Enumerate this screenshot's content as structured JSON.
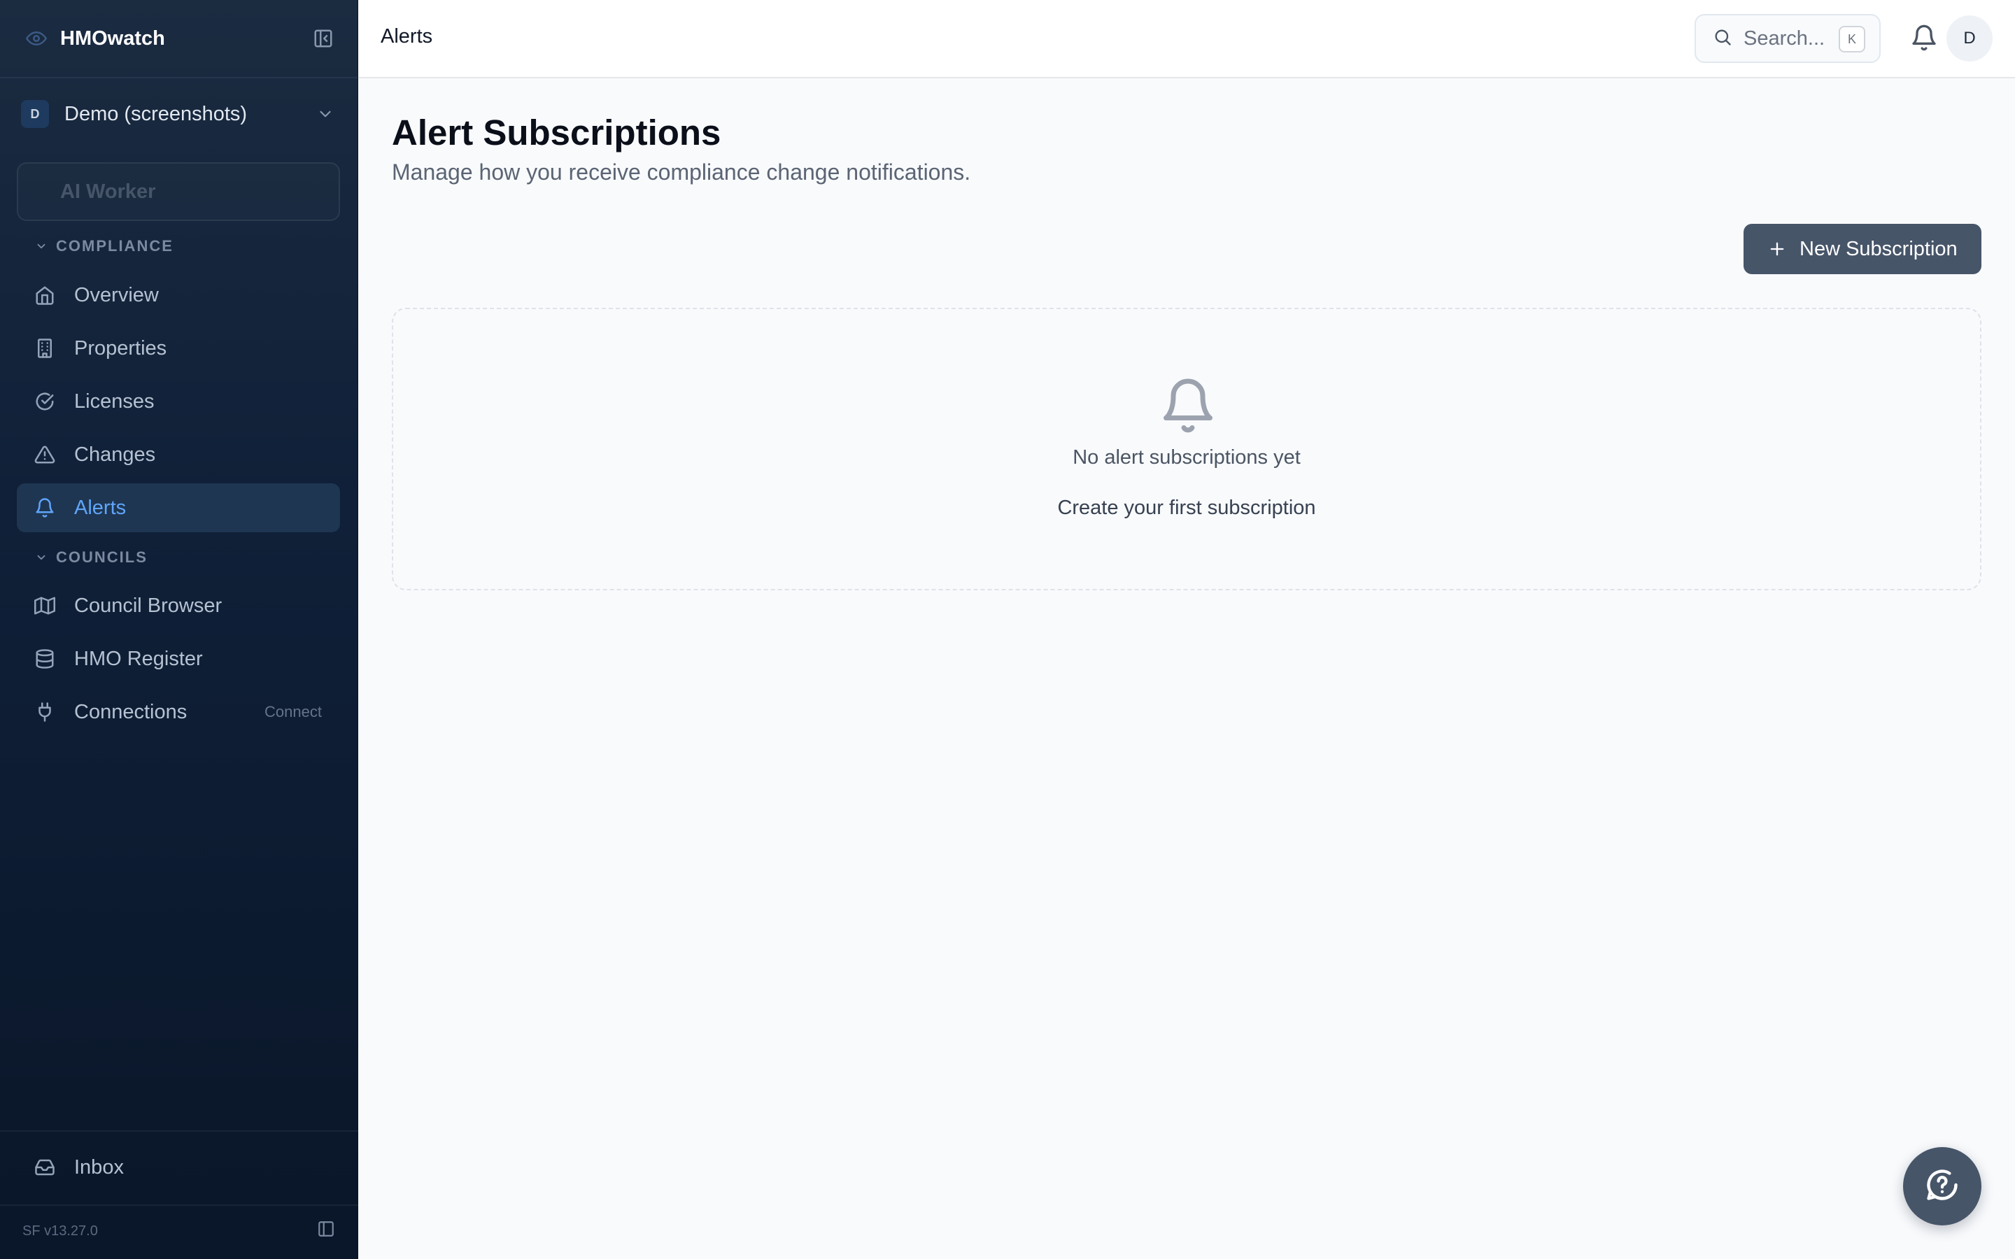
{
  "app": {
    "name": "HMOwatch",
    "version": "SF v13.27.0"
  },
  "org": {
    "badge": "D",
    "name": "Demo (screenshots)"
  },
  "sidebar": {
    "ai_worker": "AI Worker",
    "sections": [
      {
        "label": "COMPLIANCE"
      },
      {
        "label": "COUNCILS"
      }
    ],
    "compliance_items": [
      {
        "label": "Overview",
        "icon": "home-icon"
      },
      {
        "label": "Properties",
        "icon": "building-icon"
      },
      {
        "label": "Licenses",
        "icon": "check-circle-icon"
      },
      {
        "label": "Changes",
        "icon": "warning-triangle-icon"
      },
      {
        "label": "Alerts",
        "icon": "bell-icon",
        "active": true
      }
    ],
    "council_items": [
      {
        "label": "Council Browser",
        "icon": "map-icon"
      },
      {
        "label": "HMO Register",
        "icon": "database-icon"
      },
      {
        "label": "Connections",
        "icon": "plug-icon",
        "badge": "Connect"
      }
    ],
    "inbox": {
      "label": "Inbox",
      "icon": "inbox-icon"
    }
  },
  "header": {
    "breadcrumb": "Alerts",
    "search": {
      "placeholder": "Search...",
      "shortcut": "K"
    },
    "avatar_initial": "D"
  },
  "main": {
    "title": "Alert Subscriptions",
    "subtitle": "Manage how you receive compliance change notifications.",
    "new_button": "New Subscription",
    "empty": {
      "title": "No alert subscriptions yet",
      "action": "Create your first subscription"
    }
  },
  "colors": {
    "sidebar_bg": "#0f2038",
    "accent": "#60a5fa",
    "button": "#475569",
    "page_bg": "#f8fafc"
  }
}
